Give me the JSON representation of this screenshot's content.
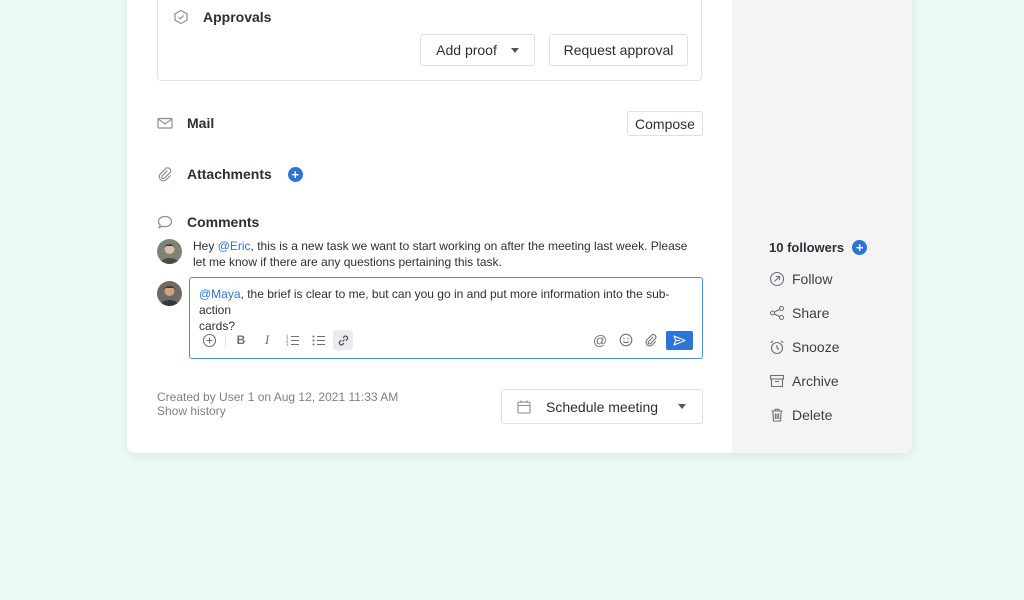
{
  "approvals": {
    "title": "Approvals",
    "add_proof_label": "Add proof",
    "request_approval_label": "Request approval"
  },
  "mail": {
    "title": "Mail",
    "compose_label": "Compose"
  },
  "attachments": {
    "title": "Attachments"
  },
  "comments": {
    "title": "Comments",
    "items": [
      {
        "prefix": "Hey ",
        "mention": "@Eric",
        "line1": ", this is a new task we want to start working on after the meeting last week. Please",
        "line2": "let me know if there are any questions pertaining this task."
      }
    ],
    "draft": {
      "mention": "@Maya",
      "line1": ", the brief is clear to me, but can you go in and put more information into the sub-action",
      "line2": "cards?"
    }
  },
  "footer": {
    "created_text": "Created by User 1 on Aug 12, 2021 11:33 AM",
    "history_link": "Show history",
    "schedule_label": "Schedule meeting"
  },
  "sidebar": {
    "followers_label": "10 followers",
    "actions": [
      {
        "label": "Follow",
        "icon": "follow-icon"
      },
      {
        "label": "Share",
        "icon": "share-icon"
      },
      {
        "label": "Snooze",
        "icon": "alarm-clock-icon"
      },
      {
        "label": "Archive",
        "icon": "archive-icon"
      },
      {
        "label": "Delete",
        "icon": "trash-icon"
      }
    ]
  },
  "colors": {
    "accent": "#2b74d8",
    "page_background": "#e9fbf2",
    "sidebar_background": "#f4f4f4"
  }
}
